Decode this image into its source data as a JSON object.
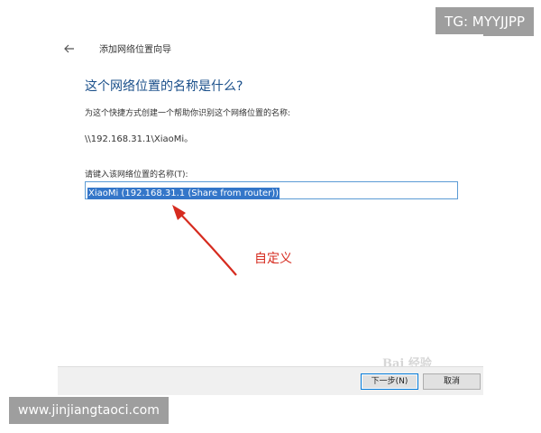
{
  "badges": {
    "top_right": "TG: MYYJJPP",
    "bottom_left": "www.jinjiangtaoci.com"
  },
  "wizard": {
    "title": "添加网络位置向导",
    "heading": "这个网络位置的名称是什么?",
    "description": "为这个快捷方式创建一个帮助你识别这个网络位置的名称:",
    "path": "\\\\192.168.31.1\\XiaoMi。",
    "input_label": "请键入该网络位置的名称(T):",
    "input_value": "XiaoMi (192.168.31.1 (Share from router))"
  },
  "annotation": {
    "text": "自定义",
    "color": "#d62b1f"
  },
  "footer": {
    "next_label": "下一步(N)",
    "cancel_label": "取消"
  },
  "watermark": {
    "text": "Bai 经验"
  },
  "icons": {
    "back": "back-arrow-icon"
  },
  "colors": {
    "heading": "#1a4f8a",
    "selection": "#3476c9",
    "input_border": "#5b9bd5",
    "badge_bg": "#9e9e9e"
  }
}
